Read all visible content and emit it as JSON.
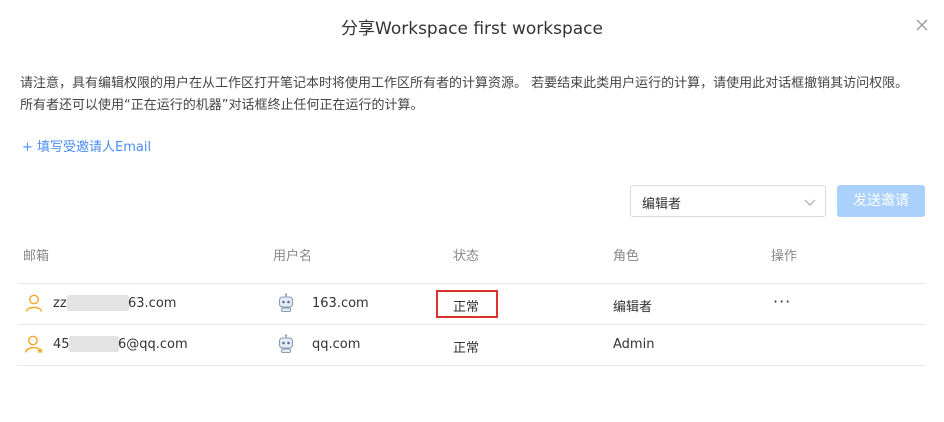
{
  "dialog": {
    "title": "分享Workspace first workspace",
    "close_icon": "close-icon"
  },
  "notice": {
    "text": "请注意，具有编辑权限的用户在从工作区打开笔记本时将使用工作区所有者的计算资源。 若要结束此类用户运行的计算，请使用此对话框撤销其访问权限。 所有者还可以使用“正在运行的机器”对话框终止任何正在运行的计算。"
  },
  "invite": {
    "link_label": "+ 填写受邀请人Email"
  },
  "controls": {
    "role_select_value": "编辑者",
    "send_button_label": "发送邀请"
  },
  "table": {
    "headers": [
      "邮箱",
      "用户名",
      "状态",
      "角色",
      "操作"
    ],
    "rows": [
      {
        "email_prefix": "zz",
        "email_suffix": "63.com",
        "username": "163.com",
        "status": "正常",
        "role": "编辑者",
        "actions": "···",
        "user_icon": "user-icon",
        "avatar_icon": "robot-avatar-icon"
      },
      {
        "email_prefix": "45",
        "email_suffix": "6@qq.com",
        "username": "qq.com",
        "status": "正常",
        "role": "Admin",
        "actions": "",
        "user_icon": "owner-user-icon",
        "avatar_icon": "robot-avatar-icon"
      }
    ]
  },
  "colors": {
    "accent": "#4a8df8",
    "button_disabled": "#a9d1fb",
    "user_icon": "#f5a623",
    "highlight_border": "#d9342b"
  }
}
